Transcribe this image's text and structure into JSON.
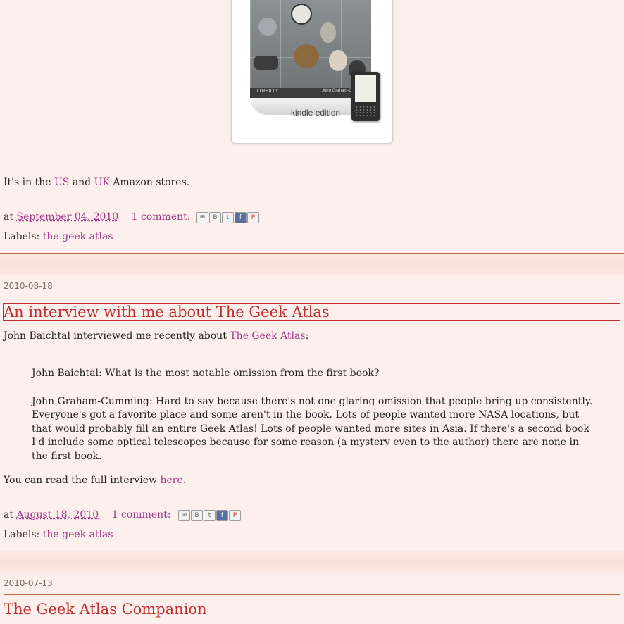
{
  "top_post": {
    "image": {
      "publisher": "O'REILLY",
      "author": "John Graham-Cumming",
      "badge": "kindle edition"
    },
    "availability": {
      "prefix": "It's in the",
      "link_us": "US",
      "and": "and",
      "link_uk": "UK",
      "suffix": "Amazon stores."
    },
    "footer": {
      "at": "at",
      "date": "September 04, 2010",
      "comments": "1 comment:",
      "labels_prefix": "Labels:",
      "label": "the geek atlas"
    }
  },
  "post_2": {
    "date": "2010-08-18",
    "title": "An interview with me about The Geek Atlas",
    "intro_prefix": "John Baichtal interviewed me recently about",
    "intro_link": "The Geek Atlas",
    "intro_suffix": ":",
    "quote_q": "John Baichtal: What is the most notable omission from the first book?",
    "quote_a": "John Graham-Cumming: Hard to say because there's not one glaring omission that people bring up consistently. Everyone's got a favorite place and some aren't in the book. Lots of people wanted more NASA locations, but that would probably fill an entire Geek Atlas! Lots of people wanted more sites in Asia. If there's a second book I'd include some optical telescopes because for some reason (a mystery even to the author) there are none in the first book.",
    "read_prefix": "You can read the full interview",
    "read_link": "here.",
    "footer": {
      "at": "at",
      "date": "August 18, 2010",
      "comments": "1 comment:",
      "labels_prefix": "Labels:",
      "label": "the geek atlas"
    }
  },
  "post_3": {
    "date": "2010-07-13",
    "title": "The Geek Atlas Companion"
  },
  "share_icons": [
    "email-icon",
    "blogger-icon",
    "twitter-icon",
    "facebook-icon",
    "pinterest-icon"
  ],
  "colors": {
    "background": "#fdf0ec",
    "link": "#a2358e",
    "title": "#c12e2e",
    "rule": "#b86a4e"
  }
}
